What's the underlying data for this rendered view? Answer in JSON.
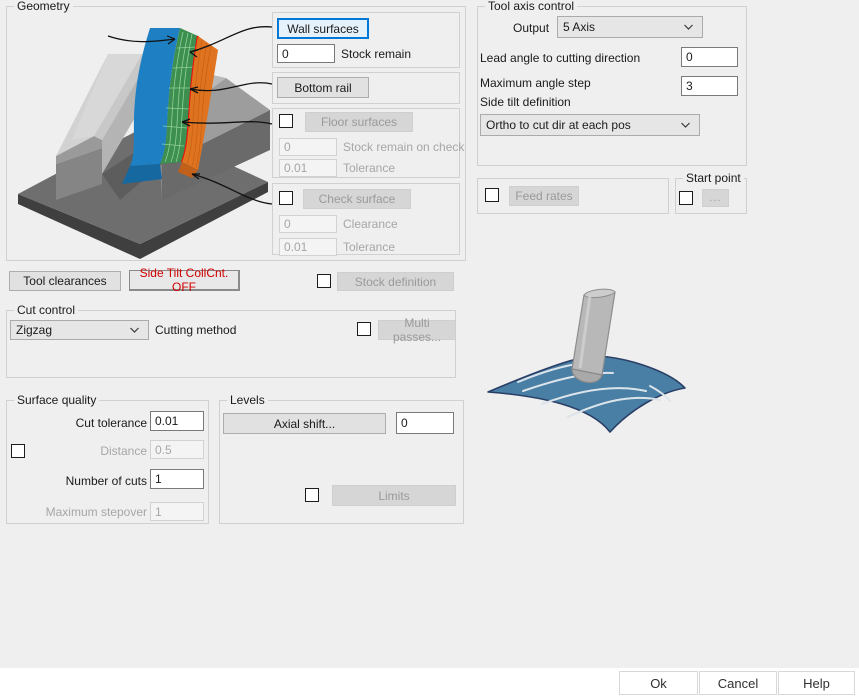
{
  "geometry": {
    "legend": "Geometry",
    "wall_surfaces_button": "Wall surfaces",
    "stock_remain_value": "0",
    "stock_remain_label": "Stock remain",
    "bottom_rail_button": "Bottom rail",
    "floor_surfaces_button": "Floor surfaces",
    "floor_stock_remain_value": "0",
    "floor_stock_remain_label": "Stock remain on check",
    "floor_tolerance_value": "0.01",
    "floor_tolerance_label": "Tolerance",
    "check_surface_button": "Check surface",
    "check_clearance_value": "0",
    "check_clearance_label": "Clearance",
    "check_tolerance_value": "0.01",
    "check_tolerance_label": "Tolerance"
  },
  "tool_axis_control": {
    "legend": "Tool axis control",
    "output_label": "Output",
    "output_value": "5 Axis",
    "lead_angle_label": "Lead angle to cutting direction",
    "lead_angle_value": "0",
    "max_angle_step_label": "Maximum angle step",
    "max_angle_step_value": "3",
    "side_tilt_label": "Side tilt definition",
    "side_tilt_value": "Ortho to cut dir at each pos"
  },
  "feed_rates": {
    "button": "Feed rates"
  },
  "start_point": {
    "legend": "Start point",
    "button": "..."
  },
  "toolbar": {
    "tool_clearances_button": "Tool clearances",
    "side_tilt_collcnt_button": "Side Tilt CollCnt. OFF",
    "stock_definition_button": "Stock definition"
  },
  "cut_control": {
    "legend": "Cut control",
    "cutting_method_value": "Zigzag",
    "cutting_method_label": "Cutting method",
    "multi_passes_button": "Multi passes..."
  },
  "surface_quality": {
    "legend": "Surface quality",
    "cut_tolerance_label": "Cut tolerance",
    "cut_tolerance_value": "0.01",
    "distance_label": "Distance",
    "distance_value": "0.5",
    "number_of_cuts_label": "Number of cuts",
    "number_of_cuts_value": "1",
    "maximum_stepover_label": "Maximum stepover",
    "maximum_stepover_value": "1"
  },
  "levels": {
    "legend": "Levels",
    "axial_shift_button": "Axial shift...",
    "axial_shift_value": "0",
    "limits_button": "Limits"
  },
  "footer": {
    "ok": "Ok",
    "cancel": "Cancel",
    "help": "Help"
  },
  "colors": {
    "background": "#efefef",
    "focus_blue": "#0078d7",
    "warning_red": "#d00000",
    "surface_blue": "#4a7fa5",
    "wall_blue": "#1e7fc2",
    "wall_green": "#3d8f4f",
    "wall_orange": "#e0731f",
    "rail_red": "#e81010",
    "stock_gray": "#808080"
  }
}
